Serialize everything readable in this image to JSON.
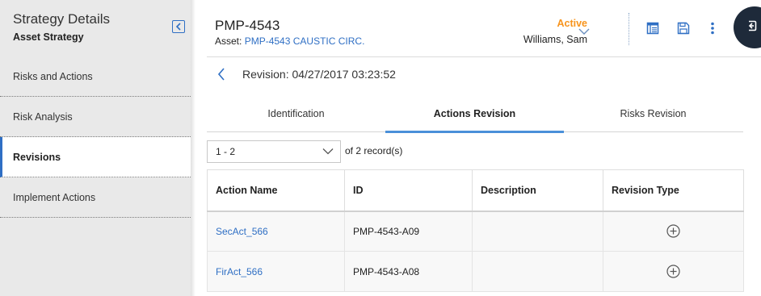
{
  "sidebar": {
    "title": "Strategy Details",
    "subtitle": "Asset Strategy",
    "items": [
      {
        "label": "Risks and Actions"
      },
      {
        "label": "Risk Analysis"
      },
      {
        "label": "Revisions",
        "active": true
      },
      {
        "label": "Implement Actions"
      }
    ]
  },
  "header": {
    "record_id": "PMP-4543",
    "asset_prefix": "Asset:",
    "asset_link": "PMP-4543 CAUSTIC CIRC.",
    "status": "Active",
    "owner": "Williams, Sam",
    "icons": [
      "layout-icon",
      "save-icon",
      "more-vertical-icon"
    ]
  },
  "revision": {
    "label": "Revision: 04/27/2017 03:23:52"
  },
  "tabs": [
    {
      "label": "Identification"
    },
    {
      "label": "Actions Revision",
      "active": true
    },
    {
      "label": "Risks Revision"
    }
  ],
  "pager": {
    "selected": "1 - 2",
    "summary": "of 2 record(s)"
  },
  "table": {
    "columns": [
      "Action Name",
      "ID",
      "Description",
      "Revision Type"
    ],
    "rows": [
      {
        "action_name": "SecAct_566",
        "id": "PMP-4543-A09",
        "description": "",
        "revision_type_icon": "plus-circle-icon"
      },
      {
        "action_name": "FirAct_566",
        "id": "PMP-4543-A08",
        "description": "",
        "revision_type_icon": "plus-circle-icon"
      }
    ]
  },
  "colors": {
    "accent": "#2f6fc4",
    "status_active": "#f7941d",
    "tab_underline": "#4a90d9",
    "corner_button": "#1e2a3a"
  }
}
